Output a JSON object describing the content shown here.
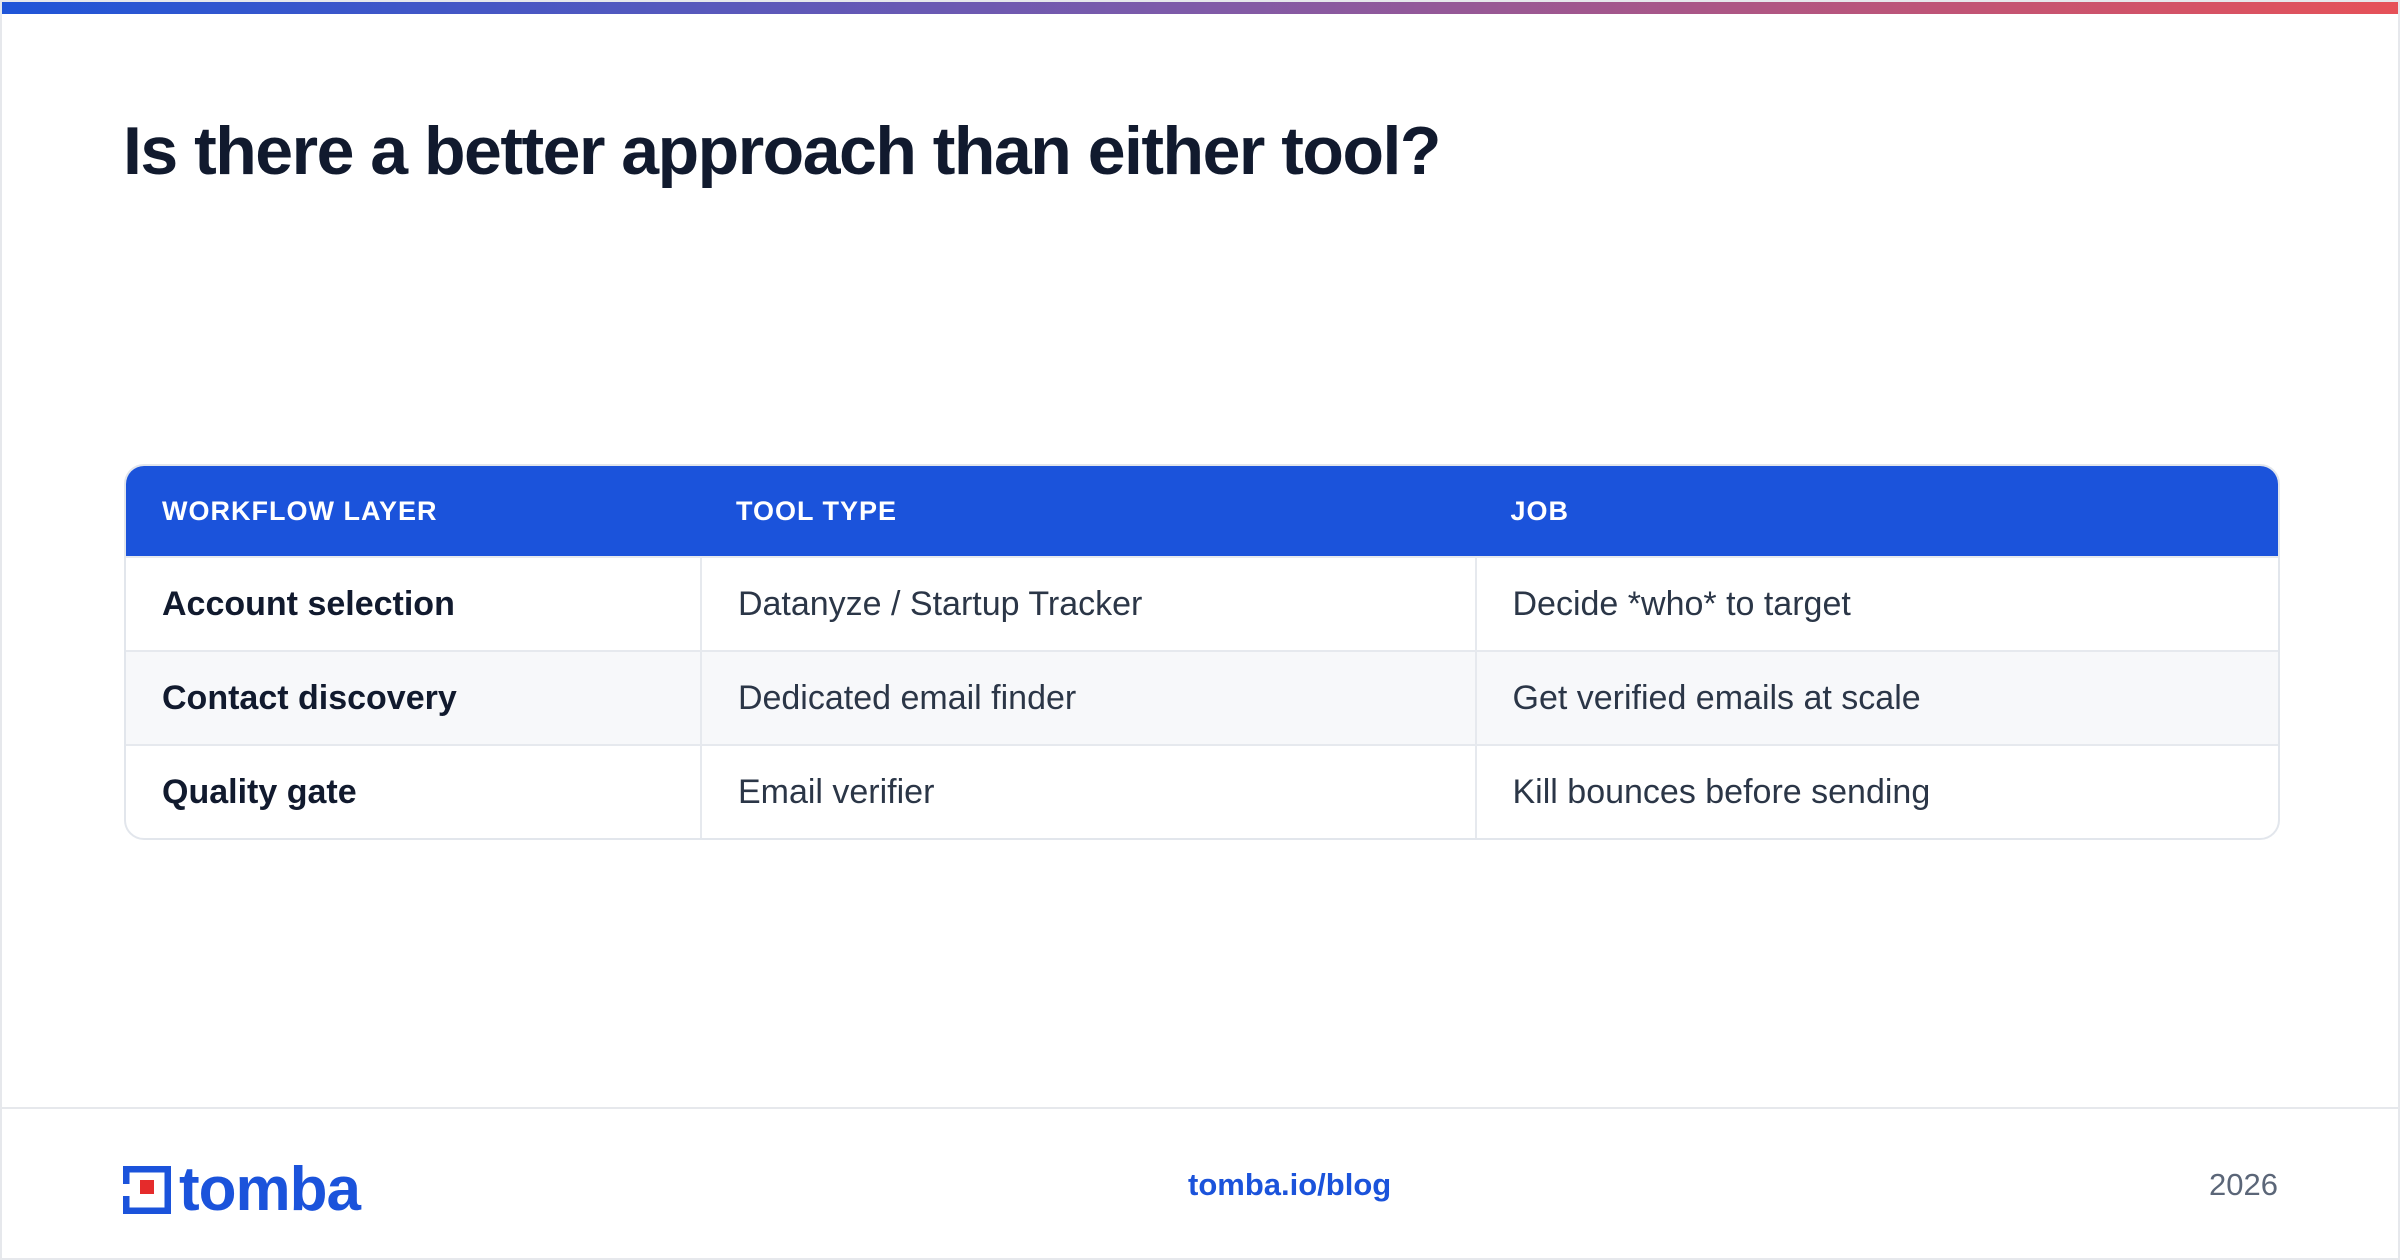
{
  "title": "Is there a better approach than either tool?",
  "table": {
    "headers": [
      "WORKFLOW LAYER",
      "TOOL TYPE",
      "JOB"
    ],
    "rows": [
      [
        "Account selection",
        "Datanyze / Startup Tracker",
        "Decide *who* to target"
      ],
      [
        "Contact discovery",
        "Dedicated email finder",
        "Get verified emails at scale"
      ],
      [
        "Quality gate",
        "Email verifier",
        "Kill bounces before sending"
      ]
    ]
  },
  "footer": {
    "logo_text": "tomba",
    "link": "tomba.io/blog",
    "year": "2026"
  },
  "colors": {
    "accent": "#1b53db",
    "logo_red": "#e52b2b",
    "title": "#111a2e"
  }
}
